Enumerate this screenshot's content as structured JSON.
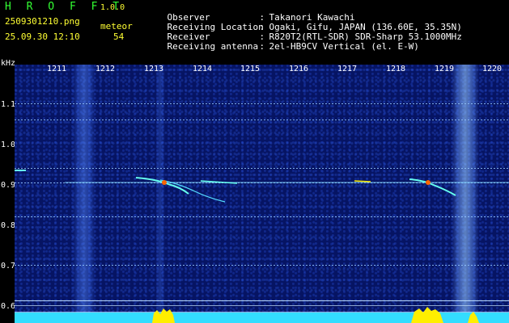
{
  "header": {
    "logo": "H R O F F T",
    "version": "1.0.0",
    "filename": "2509301210.png",
    "datetime": "25.09.30 12:10",
    "meteor_label": "meteor",
    "meteor_count": "54",
    "info": [
      {
        "key": "Observer",
        "sep": ":",
        "value": "Takanori Kawachi"
      },
      {
        "key": "Receiving Location",
        "sep": ":",
        "value": "Ogaki, Gifu, JAPAN (136.60E, 35.35N)"
      },
      {
        "key": "Receiver",
        "sep": ":",
        "value": "R820T2(RTL-SDR) SDR-Sharp 53.1000MHz"
      },
      {
        "key": "Receiving antenna",
        "sep": ":",
        "value": "2el-HB9CV Vertical (el. E-W)"
      }
    ]
  },
  "axis": {
    "y_unit": "kHz",
    "y_ticks": [
      "1.1",
      "1.0",
      "0.9",
      "0.8",
      "0.7",
      "0.6"
    ],
    "x_ticks": [
      "1211",
      "1212",
      "1213",
      "1214",
      "1215",
      "1216",
      "1217",
      "1218",
      "1219",
      "1220"
    ]
  },
  "colors": {
    "background": "#000000",
    "spectrogram_base": "#061463",
    "header_yellow": "#ffff33",
    "logo_green": "#33ff33",
    "signal_cyan": "#66ffee",
    "meteor_orange": "#ff6600",
    "signal_yellow": "#ffee00"
  }
}
